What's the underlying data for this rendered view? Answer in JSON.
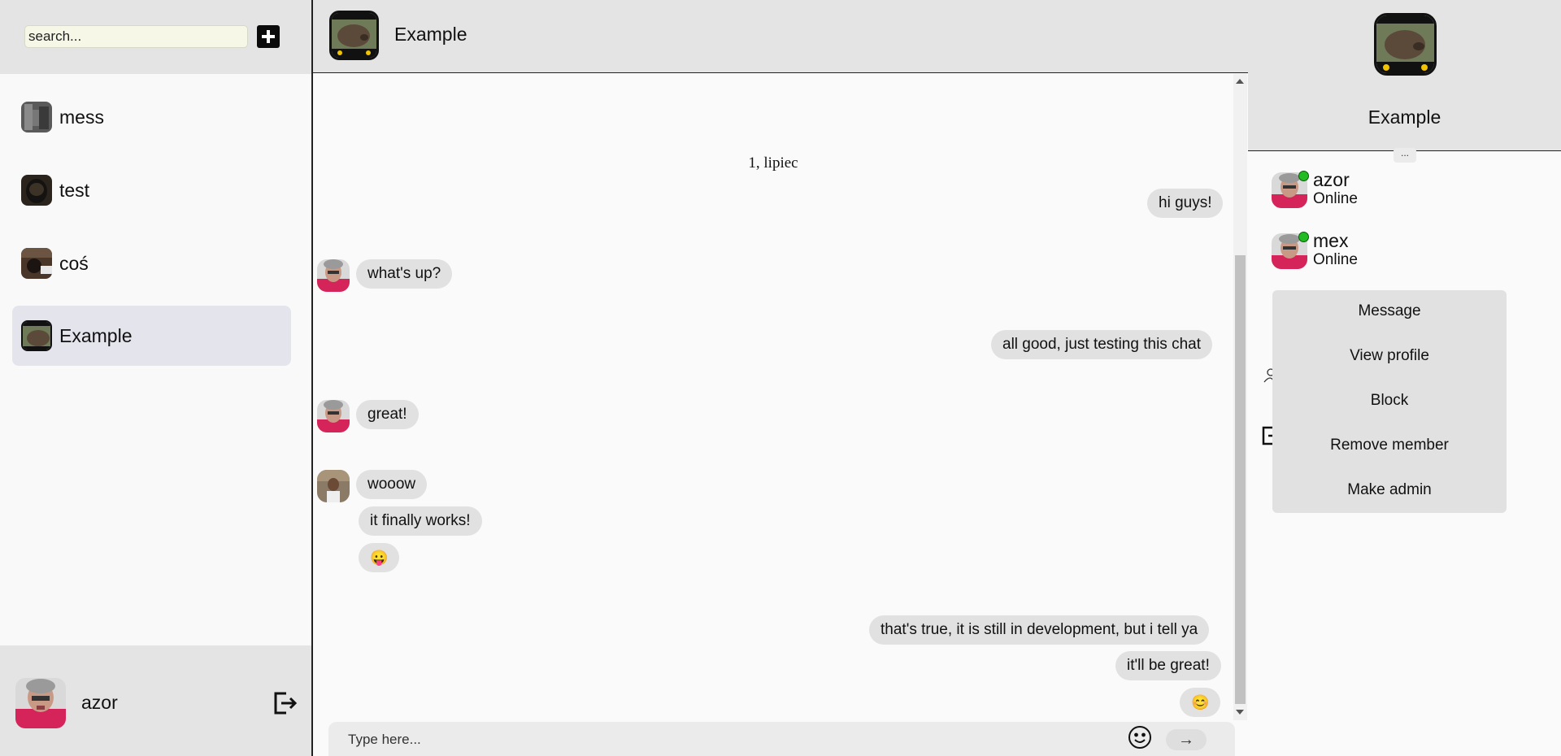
{
  "search": {
    "placeholder": "search..."
  },
  "sidebar": {
    "chats": [
      {
        "label": "mess",
        "active": false
      },
      {
        "label": "test",
        "active": false
      },
      {
        "label": "coś",
        "active": false
      },
      {
        "label": "Example",
        "active": true
      }
    ],
    "current_user": {
      "name": "azor"
    }
  },
  "chat": {
    "title": "Example",
    "date_separator": "1, lipiec",
    "messages": [
      {
        "text": "hi guys!",
        "side": "right"
      },
      {
        "text": "what's up?",
        "side": "left"
      },
      {
        "text": "all good, just testing this chat",
        "side": "right"
      },
      {
        "text": "great!",
        "side": "left"
      },
      {
        "text": "wooow",
        "side": "left"
      },
      {
        "text": "it finally works!",
        "side": "left"
      },
      {
        "text": "😛",
        "side": "left"
      },
      {
        "text": "that's true, it is still in development, but i tell ya",
        "side": "right"
      },
      {
        "text": "it'll be great!",
        "side": "right"
      },
      {
        "text": "😊",
        "side": "right"
      }
    ],
    "input_placeholder": "Type here...",
    "send_label": "→",
    "icons": {
      "emoji": "smiley-icon",
      "send": "arrow-right-icon"
    }
  },
  "panel": {
    "title": "Example",
    "more_label": "...",
    "members": [
      {
        "name": "azor",
        "status": "Online"
      },
      {
        "name": "mex",
        "status": "Online"
      }
    ],
    "context_menu": [
      "Message",
      "View profile",
      "Block",
      "Remove member",
      "Make admin"
    ]
  },
  "colors": {
    "header_bg": "#e4e4e4",
    "bubble_bg": "#e1e1e1",
    "active_chat_bg": "#e4e4ec",
    "online_dot": "#22bb22"
  }
}
